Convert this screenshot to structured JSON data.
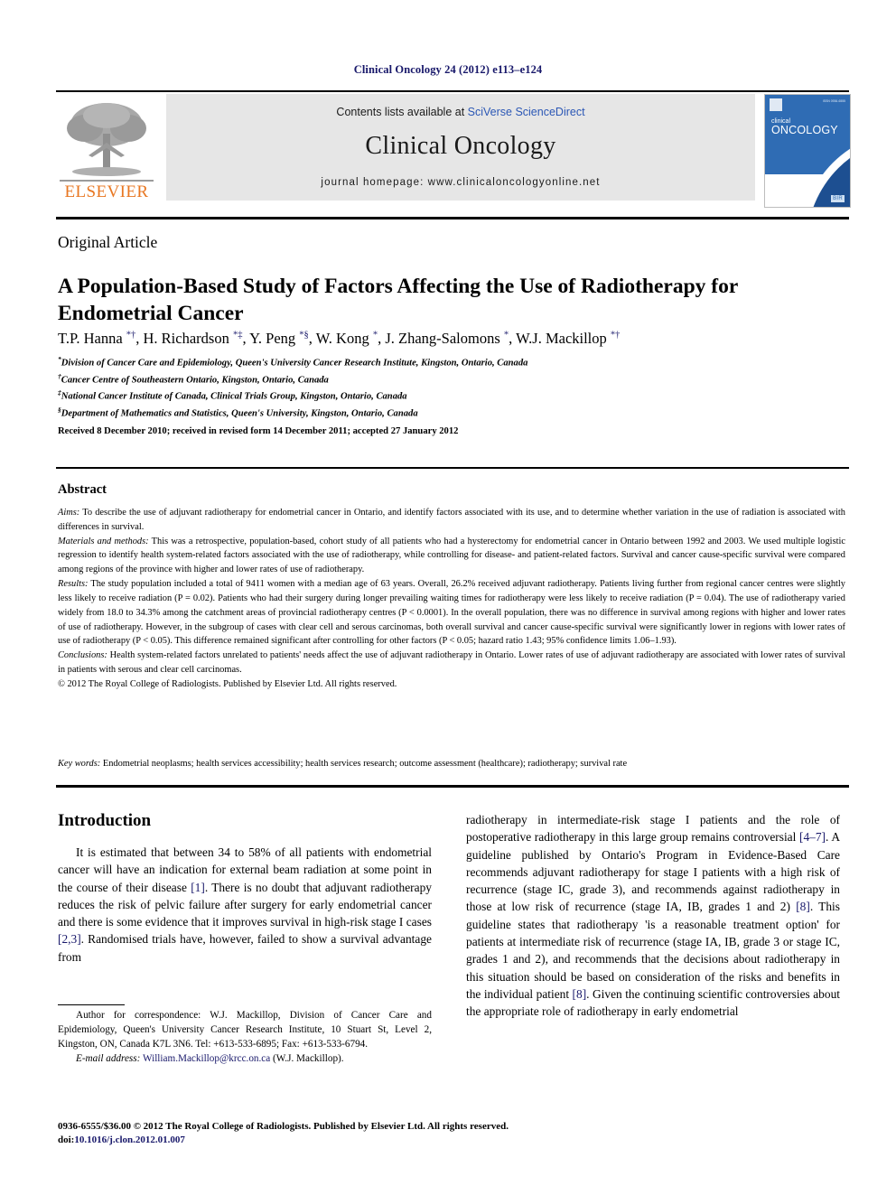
{
  "running_head": "Clinical Oncology 24 (2012) e113–e124",
  "masthead": {
    "contents_prefix": "Contents lists available at ",
    "contents_link": "SciVerse ScienceDirect",
    "journal_title": "Clinical Oncology",
    "homepage_label": "journal homepage: www.clinicaloncologyonline.net",
    "publisher_name": "ELSEVIER",
    "publisher_logo_icon": "elsevier-tree-icon",
    "cover": {
      "title_small": "clinical",
      "title_big": "ONCOLOGY",
      "issn_mark": "ISSN 0936-6555",
      "footer_mark": "BIR",
      "color": "#2f6cb4"
    }
  },
  "article": {
    "type": "Original Article",
    "title": "A Population-Based Study of Factors Affecting the Use of Radiotherapy for Endometrial Cancer",
    "authors_html": "T.P. Hanna <sup>*</sup><sup>†</sup>, H. Richardson <sup>*</sup><sup>‡</sup>, Y. Peng <sup>*</sup><sup>§</sup>, W. Kong <sup>*</sup>, J. Zhang-Salomons <sup>*</sup>, W.J. Mackillop <sup>*</sup><sup>†</sup>",
    "affiliations": [
      {
        "marker": "*",
        "text": "Division of Cancer Care and Epidemiology, Queen's University Cancer Research Institute, Kingston, Ontario, Canada"
      },
      {
        "marker": "†",
        "text": "Cancer Centre of Southeastern Ontario, Kingston, Ontario, Canada"
      },
      {
        "marker": "‡",
        "text": "National Cancer Institute of Canada, Clinical Trials Group, Kingston, Ontario, Canada"
      },
      {
        "marker": "§",
        "text": "Department of Mathematics and Statistics, Queen's University, Kingston, Ontario, Canada"
      }
    ],
    "history": "Received 8 December 2010; received in revised form 14 December 2011; accepted 27 January 2012"
  },
  "abstract": {
    "heading": "Abstract",
    "sections": [
      {
        "label": "Aims:",
        "text": " To describe the use of adjuvant radiotherapy for endometrial cancer in Ontario, and identify factors associated with its use, and to determine whether variation in the use of radiation is associated with differences in survival."
      },
      {
        "label": "Materials and methods:",
        "text": " This was a retrospective, population-based, cohort study of all patients who had a hysterectomy for endometrial cancer in Ontario between 1992 and 2003. We used multiple logistic regression to identify health system-related factors associated with the use of radiotherapy, while controlling for disease- and patient-related factors. Survival and cancer cause-specific survival were compared among regions of the province with higher and lower rates of use of radiotherapy."
      },
      {
        "label": "Results:",
        "text": " The study population included a total of 9411 women with a median age of 63 years. Overall, 26.2% received adjuvant radiotherapy. Patients living further from regional cancer centres were slightly less likely to receive radiation (P = 0.02). Patients who had their surgery during longer prevailing waiting times for radiotherapy were less likely to receive radiation (P = 0.04). The use of radiotherapy varied widely from 18.0 to 34.3% among the catchment areas of provincial radiotherapy centres (P < 0.0001). In the overall population, there was no difference in survival among regions with higher and lower rates of use of radiotherapy. However, in the subgroup of cases with clear cell and serous carcinomas, both overall survival and cancer cause-specific survival were significantly lower in regions with lower rates of use of radiotherapy (P < 0.05). This difference remained significant after controlling for other factors (P < 0.05; hazard ratio 1.43; 95% confidence limits 1.06–1.93)."
      },
      {
        "label": "Conclusions:",
        "text": " Health system-related factors unrelated to patients' needs affect the use of adjuvant radiotherapy in Ontario. Lower rates of use of adjuvant radiotherapy are associated with lower rates of survival in patients with serous and clear cell carcinomas."
      }
    ],
    "copyright": "© 2012 The Royal College of Radiologists. Published by Elsevier Ltd. All rights reserved.",
    "keywords_label": "Key words:",
    "keywords_text": " Endometrial neoplasms; health services accessibility; health services research; outcome assessment (healthcare); radiotherapy; survival rate"
  },
  "introduction": {
    "heading": "Introduction",
    "left_paragraph_html": "It is estimated that between 34 to 58% of all patients with endometrial cancer will have an indication for external beam radiation at some point in the course of their disease <span class=\"ref\">[1]</span>. There is no doubt that adjuvant radiotherapy reduces the risk of pelvic failure after surgery for early endometrial cancer and there is some evidence that it improves survival in high-risk stage I cases <span class=\"ref\">[2,3]</span>. Randomised trials have, however, failed to show a survival advantage from",
    "right_paragraph_html": "radiotherapy in intermediate-risk stage I patients and the role of postoperative radiotherapy in this large group remains controversial <span class=\"ref\">[4–7]</span>. A guideline published by Ontario's Program in Evidence-Based Care recommends adjuvant radiotherapy for stage I patients with a high risk of recurrence (stage IC, grade 3), and recommends against radiotherapy in those at low risk of recurrence (stage IA, IB, grades 1 and 2) <span class=\"ref\">[8]</span>. This guideline states that radiotherapy 'is a reasonable treatment option' for patients at intermediate risk of recurrence (stage IA, IB, grade 3 or stage IC, grades 1 and 2), and recommends that the decisions about radiotherapy in this situation should be based on consideration of the risks and benefits in the individual patient <span class=\"ref\">[8]</span>. Given the continuing scientific controversies about the appropriate role of radiotherapy in early endometrial"
  },
  "footnote": {
    "correspondence_html": "Author for correspondence: W.J. Mackillop, Division of Cancer Care and Epidemiology, Queen's University Cancer Research Institute, 10 Stuart St, Level 2, Kingston, ON, Canada K7L 3N6. Tel: +613-533-6895; Fax: +613-533-6794.",
    "email_label": "E-mail address:",
    "email": "William.Mackillop@krcc.on.ca",
    "email_owner": "(W.J. Mackillop)."
  },
  "footer": {
    "issn_line": "0936-6555/$36.00 © 2012 The Royal College of Radiologists. Published by Elsevier Ltd. All rights reserved.",
    "doi_label": "doi:",
    "doi_value": "10.1016/j.clon.2012.01.007"
  }
}
